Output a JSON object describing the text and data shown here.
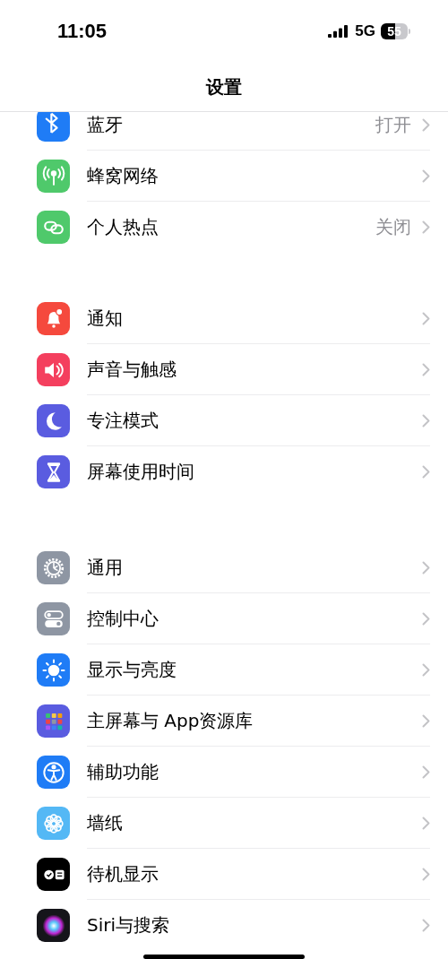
{
  "status_bar": {
    "time": "11:05",
    "network": "5G",
    "battery": "55"
  },
  "navigation": {
    "title": "设置"
  },
  "groups": [
    {
      "items": [
        {
          "label": "蓝牙",
          "value": "打开"
        },
        {
          "label": "蜂窝网络"
        },
        {
          "label": "个人热点",
          "value": "关闭"
        }
      ]
    },
    {
      "items": [
        {
          "label": "通知"
        },
        {
          "label": "声音与触感"
        },
        {
          "label": "专注模式"
        },
        {
          "label": "屏幕使用时间"
        }
      ]
    },
    {
      "items": [
        {
          "label": "通用"
        },
        {
          "label": "控制中心"
        },
        {
          "label": "显示与亮度"
        },
        {
          "label": "主屏幕与 App资源库"
        },
        {
          "label": "辅助功能"
        },
        {
          "label": "墙纸"
        },
        {
          "label": "待机显示"
        },
        {
          "label": "Siri与搜索"
        }
      ]
    }
  ]
}
